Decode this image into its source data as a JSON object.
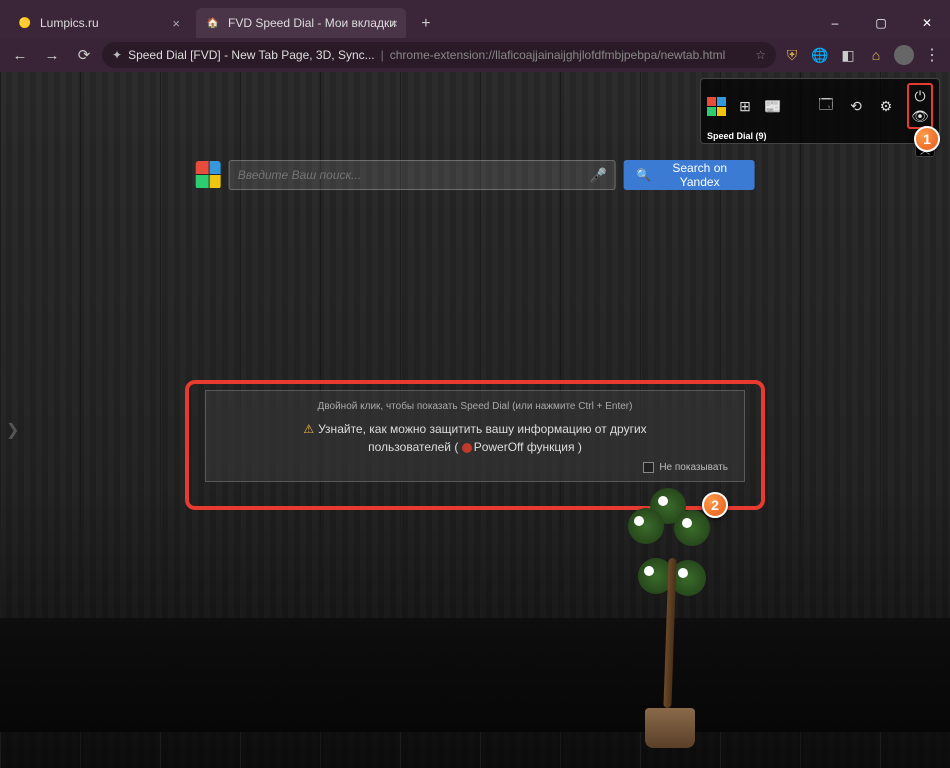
{
  "titlebar": {
    "tabs": [
      {
        "title": "Lumpics.ru",
        "favicon": "🟡"
      },
      {
        "title": "FVD Speed Dial - Мои вкладки",
        "favicon": "🏠"
      }
    ],
    "newtab": "+",
    "min": "–",
    "max": "▢",
    "close": "✕"
  },
  "addrbar": {
    "page_title": "Speed Dial [FVD] - New Tab Page, 3D, Sync...",
    "separator": "|",
    "url": "chrome-extension://llaficoajjainaijghjlofdfmbjpebpa/newtab.html"
  },
  "sd_toolbar": {
    "label": "Speed Dial (9)"
  },
  "search": {
    "placeholder": "Введите Ваш поиск...",
    "yandex_label": "Search on Yandex"
  },
  "message_panel": {
    "hint": "Двойной клик, чтобы показать Speed Dial (или нажмите Ctrl + Enter)",
    "line1_prefix": "Узнайте, как можно защитить вашу информацию от других",
    "line2_prefix": "пользователей ( ",
    "poweroff_label": "PowerOff функция",
    "line2_suffix": " )",
    "dont_show_label": "Не показывать"
  },
  "callouts": {
    "one": "1",
    "two": "2"
  }
}
